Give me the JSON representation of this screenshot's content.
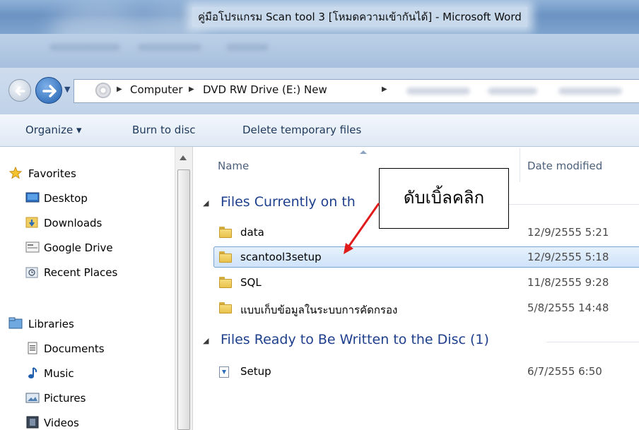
{
  "window": {
    "title": "คู่มือโปรแกรม Scan tool 3 [โหมดความเข้ากันได้] - Microsoft Word"
  },
  "address_bar": {
    "crumbs": [
      "Computer",
      "DVD RW Drive (E:) New"
    ]
  },
  "toolbar": {
    "organize": "Organize ▾",
    "burn": "Burn to disc",
    "delete_temp": "Delete temporary files"
  },
  "nav": {
    "favorites_header": "Favorites",
    "favorites": [
      "Desktop",
      "Downloads",
      "Google Drive",
      "Recent Places"
    ],
    "libraries_header": "Libraries",
    "libraries": [
      "Documents",
      "Music",
      "Pictures",
      "Videos"
    ]
  },
  "columns": {
    "name": "Name",
    "date_modified": "Date modified"
  },
  "groups": {
    "current": "Files Currently on th",
    "ready": "Files Ready to Be Written to the Disc (1)"
  },
  "files_current": [
    {
      "name": "data",
      "date": "12/9/2555 5:21"
    },
    {
      "name": "scantool3setup",
      "date": "12/9/2555 5:18",
      "selected": true
    },
    {
      "name": "SQL",
      "date": "11/8/2555 9:28"
    },
    {
      "name": "แบบเก็บข้อมูลในระบบการคัดกรอง",
      "date": "5/8/2555 14:48"
    }
  ],
  "files_ready": [
    {
      "name": "Setup",
      "date": "6/7/2555 6:50"
    }
  ],
  "annotation": {
    "text": "ดับเบิ้ลคลิก",
    "arrow_color": "#e01b1b"
  },
  "colors": {
    "group_header": "#1e3f8c",
    "selection": "#cfe3fa",
    "titlebar": "#6b93c3"
  }
}
